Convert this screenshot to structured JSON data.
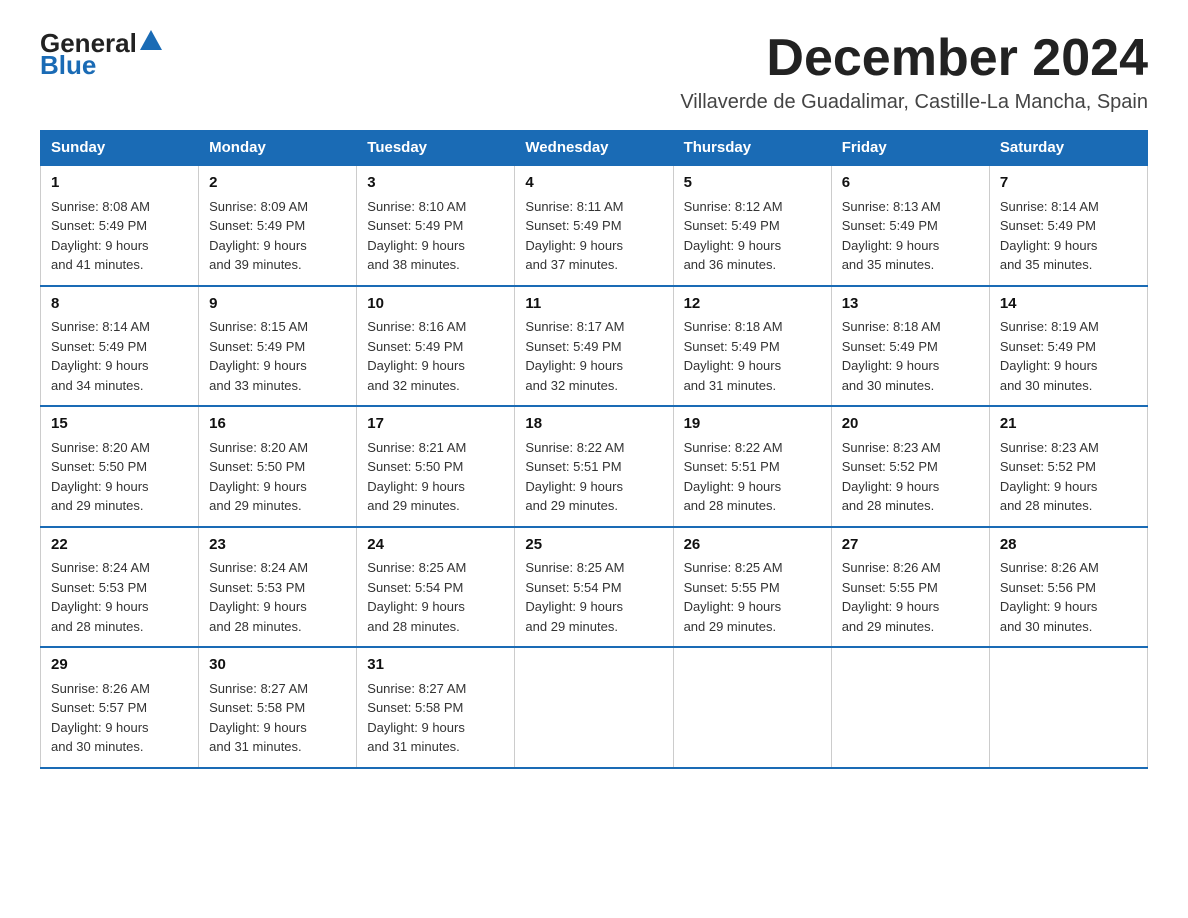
{
  "logo": {
    "general": "General",
    "blue": "Blue"
  },
  "header": {
    "title": "December 2024",
    "subtitle": "Villaverde de Guadalimar, Castille-La Mancha, Spain"
  },
  "days_of_week": [
    "Sunday",
    "Monday",
    "Tuesday",
    "Wednesday",
    "Thursday",
    "Friday",
    "Saturday"
  ],
  "weeks": [
    [
      {
        "day": "1",
        "sunrise": "8:08 AM",
        "sunset": "5:49 PM",
        "daylight": "9 hours and 41 minutes."
      },
      {
        "day": "2",
        "sunrise": "8:09 AM",
        "sunset": "5:49 PM",
        "daylight": "9 hours and 39 minutes."
      },
      {
        "day": "3",
        "sunrise": "8:10 AM",
        "sunset": "5:49 PM",
        "daylight": "9 hours and 38 minutes."
      },
      {
        "day": "4",
        "sunrise": "8:11 AM",
        "sunset": "5:49 PM",
        "daylight": "9 hours and 37 minutes."
      },
      {
        "day": "5",
        "sunrise": "8:12 AM",
        "sunset": "5:49 PM",
        "daylight": "9 hours and 36 minutes."
      },
      {
        "day": "6",
        "sunrise": "8:13 AM",
        "sunset": "5:49 PM",
        "daylight": "9 hours and 35 minutes."
      },
      {
        "day": "7",
        "sunrise": "8:14 AM",
        "sunset": "5:49 PM",
        "daylight": "9 hours and 35 minutes."
      }
    ],
    [
      {
        "day": "8",
        "sunrise": "8:14 AM",
        "sunset": "5:49 PM",
        "daylight": "9 hours and 34 minutes."
      },
      {
        "day": "9",
        "sunrise": "8:15 AM",
        "sunset": "5:49 PM",
        "daylight": "9 hours and 33 minutes."
      },
      {
        "day": "10",
        "sunrise": "8:16 AM",
        "sunset": "5:49 PM",
        "daylight": "9 hours and 32 minutes."
      },
      {
        "day": "11",
        "sunrise": "8:17 AM",
        "sunset": "5:49 PM",
        "daylight": "9 hours and 32 minutes."
      },
      {
        "day": "12",
        "sunrise": "8:18 AM",
        "sunset": "5:49 PM",
        "daylight": "9 hours and 31 minutes."
      },
      {
        "day": "13",
        "sunrise": "8:18 AM",
        "sunset": "5:49 PM",
        "daylight": "9 hours and 30 minutes."
      },
      {
        "day": "14",
        "sunrise": "8:19 AM",
        "sunset": "5:49 PM",
        "daylight": "9 hours and 30 minutes."
      }
    ],
    [
      {
        "day": "15",
        "sunrise": "8:20 AM",
        "sunset": "5:50 PM",
        "daylight": "9 hours and 29 minutes."
      },
      {
        "day": "16",
        "sunrise": "8:20 AM",
        "sunset": "5:50 PM",
        "daylight": "9 hours and 29 minutes."
      },
      {
        "day": "17",
        "sunrise": "8:21 AM",
        "sunset": "5:50 PM",
        "daylight": "9 hours and 29 minutes."
      },
      {
        "day": "18",
        "sunrise": "8:22 AM",
        "sunset": "5:51 PM",
        "daylight": "9 hours and 29 minutes."
      },
      {
        "day": "19",
        "sunrise": "8:22 AM",
        "sunset": "5:51 PM",
        "daylight": "9 hours and 28 minutes."
      },
      {
        "day": "20",
        "sunrise": "8:23 AM",
        "sunset": "5:52 PM",
        "daylight": "9 hours and 28 minutes."
      },
      {
        "day": "21",
        "sunrise": "8:23 AM",
        "sunset": "5:52 PM",
        "daylight": "9 hours and 28 minutes."
      }
    ],
    [
      {
        "day": "22",
        "sunrise": "8:24 AM",
        "sunset": "5:53 PM",
        "daylight": "9 hours and 28 minutes."
      },
      {
        "day": "23",
        "sunrise": "8:24 AM",
        "sunset": "5:53 PM",
        "daylight": "9 hours and 28 minutes."
      },
      {
        "day": "24",
        "sunrise": "8:25 AM",
        "sunset": "5:54 PM",
        "daylight": "9 hours and 28 minutes."
      },
      {
        "day": "25",
        "sunrise": "8:25 AM",
        "sunset": "5:54 PM",
        "daylight": "9 hours and 29 minutes."
      },
      {
        "day": "26",
        "sunrise": "8:25 AM",
        "sunset": "5:55 PM",
        "daylight": "9 hours and 29 minutes."
      },
      {
        "day": "27",
        "sunrise": "8:26 AM",
        "sunset": "5:55 PM",
        "daylight": "9 hours and 29 minutes."
      },
      {
        "day": "28",
        "sunrise": "8:26 AM",
        "sunset": "5:56 PM",
        "daylight": "9 hours and 30 minutes."
      }
    ],
    [
      {
        "day": "29",
        "sunrise": "8:26 AM",
        "sunset": "5:57 PM",
        "daylight": "9 hours and 30 minutes."
      },
      {
        "day": "30",
        "sunrise": "8:27 AM",
        "sunset": "5:58 PM",
        "daylight": "9 hours and 31 minutes."
      },
      {
        "day": "31",
        "sunrise": "8:27 AM",
        "sunset": "5:58 PM",
        "daylight": "9 hours and 31 minutes."
      },
      null,
      null,
      null,
      null
    ]
  ],
  "labels": {
    "sunrise": "Sunrise:",
    "sunset": "Sunset:",
    "daylight": "Daylight:"
  }
}
